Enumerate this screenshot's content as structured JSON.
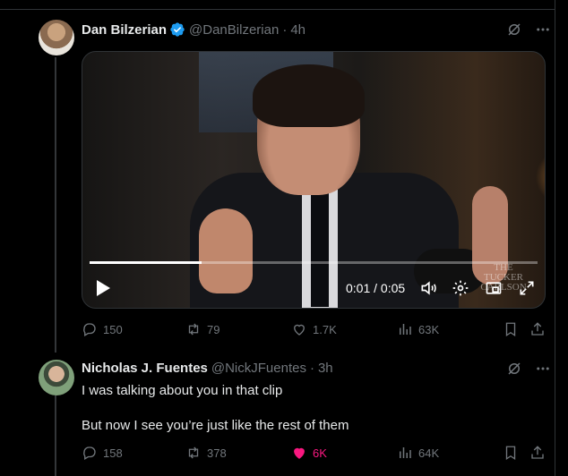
{
  "tweet1": {
    "name": "Dan Bilzerian",
    "handle": "@DanBilzerian",
    "time": "4h",
    "video": {
      "current_time": "0:01",
      "duration": "0:05",
      "time_display": "0:01 / 0:05",
      "progress": 0.25,
      "watermark": "THE TUCKER CARLSON"
    },
    "stats": {
      "replies": "150",
      "reposts": "79",
      "likes": "1.7K",
      "views": "63K"
    }
  },
  "tweet2": {
    "name": "Nicholas J. Fuentes",
    "handle": "@NickJFuentes",
    "time": "3h",
    "text_line1": "I was talking about you in that clip",
    "text_line2": "But now I see you’re just like the rest of them",
    "stats": {
      "replies": "158",
      "reposts": "378",
      "likes": "6K",
      "views": "64K"
    },
    "liked": true
  },
  "colors": {
    "background": "#000000",
    "text": "#e7e9ea",
    "muted": "#71767b",
    "verified": "#1d9bf0",
    "like": "#f91880",
    "divider": "#2f3336"
  },
  "icons": [
    "verified-badge-icon",
    "grok-icon",
    "more-icon",
    "play-icon",
    "volume-icon",
    "settings-icon",
    "pip-icon",
    "fullscreen-icon",
    "reply-icon",
    "repost-icon",
    "like-icon",
    "views-icon",
    "bookmark-icon",
    "share-icon"
  ]
}
